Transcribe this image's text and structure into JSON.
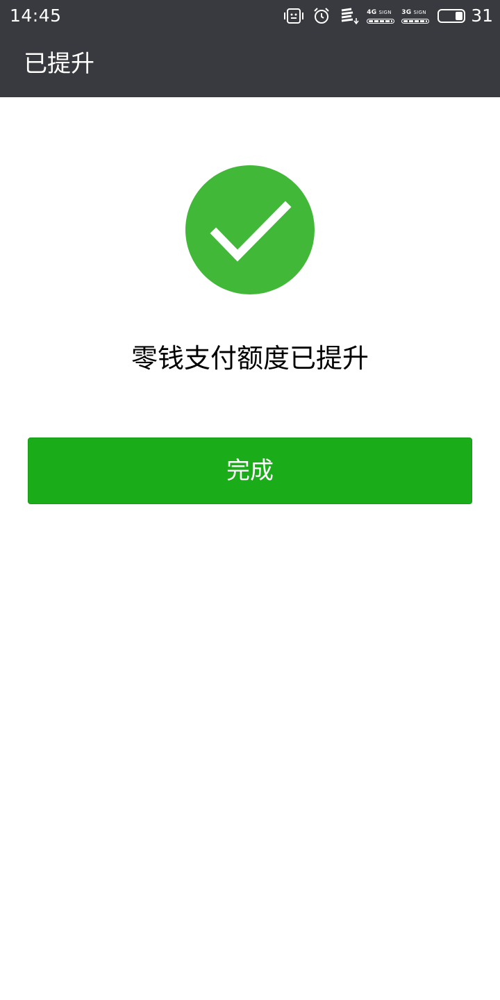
{
  "status_bar": {
    "time": "14:45",
    "icons": [
      "vibrate-icon",
      "alarm-icon",
      "data-transfer-icon"
    ],
    "signal_1": {
      "network": "4G",
      "label": "SIGN"
    },
    "signal_2": {
      "network": "3G",
      "label": "SIGN"
    },
    "battery_level": "31",
    "battery_fraction": 0.31
  },
  "header": {
    "title": "已提升",
    "background_color": "#393a3f"
  },
  "main": {
    "success_icon": "check-circle-icon",
    "success_color": "#41b837",
    "message": "零钱支付额度已提升",
    "done_button": {
      "label": "完成",
      "color": "#1aad19"
    }
  }
}
